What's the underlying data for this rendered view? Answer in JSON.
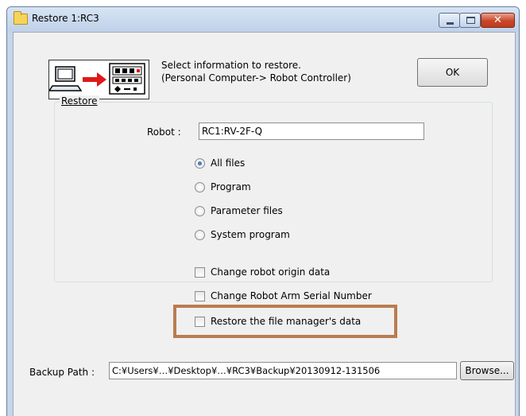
{
  "window": {
    "title": "Restore 1:RC3"
  },
  "header": {
    "instruction_line1": "Select information to restore.",
    "instruction_line2": "(Personal Computer-> Robot Controller)",
    "ok_label": "OK"
  },
  "restore_group": {
    "label": "Restore",
    "robot_label": "Robot :",
    "robot_value": "RC1:RV-2F-Q",
    "options": [
      {
        "label": "All files",
        "selected": true
      },
      {
        "label": "Program",
        "selected": false
      },
      {
        "label": "Parameter files",
        "selected": false
      },
      {
        "label": "System program",
        "selected": false
      }
    ]
  },
  "checkboxes": [
    {
      "label": "Change robot origin data",
      "checked": false
    },
    {
      "label": "Change Robot Arm Serial Number",
      "checked": false
    },
    {
      "label": "Restore the file manager's data",
      "checked": false
    }
  ],
  "backup": {
    "label": "Backup Path :",
    "value": "C:¥Users¥…¥Desktop¥…¥RC3¥Backup¥20130912-131506",
    "browse_label": "Browse..."
  },
  "colors": {
    "highlight_border": "#b97c50",
    "titlebar": "#c5d5ea",
    "close_button": "#c9462a"
  },
  "icons": [
    "folder-icon",
    "minimize-icon",
    "maximize-icon",
    "close-icon",
    "computer-to-controller-illustration"
  ]
}
